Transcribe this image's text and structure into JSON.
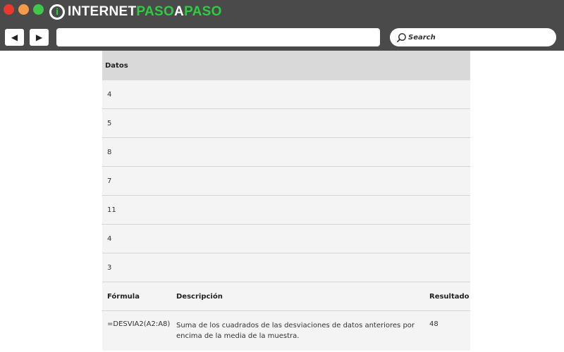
{
  "brand": {
    "logo_letter": "i",
    "name_part1": "INTERNET",
    "name_part2": "PASO",
    "name_part3": "A",
    "name_part4": "PASO",
    "accent_color": "#2ecc40"
  },
  "nav": {
    "back_icon": "◀",
    "forward_icon": "▶"
  },
  "search": {
    "placeholder": "Search"
  },
  "data_table": {
    "header": "Datos",
    "values": [
      "4",
      "5",
      "8",
      "7",
      "11",
      "4",
      "3"
    ]
  },
  "formula_table": {
    "headers": {
      "formula": "Fórmula",
      "description": "Descripción",
      "result": "Resultado"
    },
    "row": {
      "formula": "=DESVIA2(A2:A8)",
      "description": "Suma de los cuadrados de las desviaciones de datos anteriores por encima de la media de la muestra.",
      "result": "48"
    }
  }
}
